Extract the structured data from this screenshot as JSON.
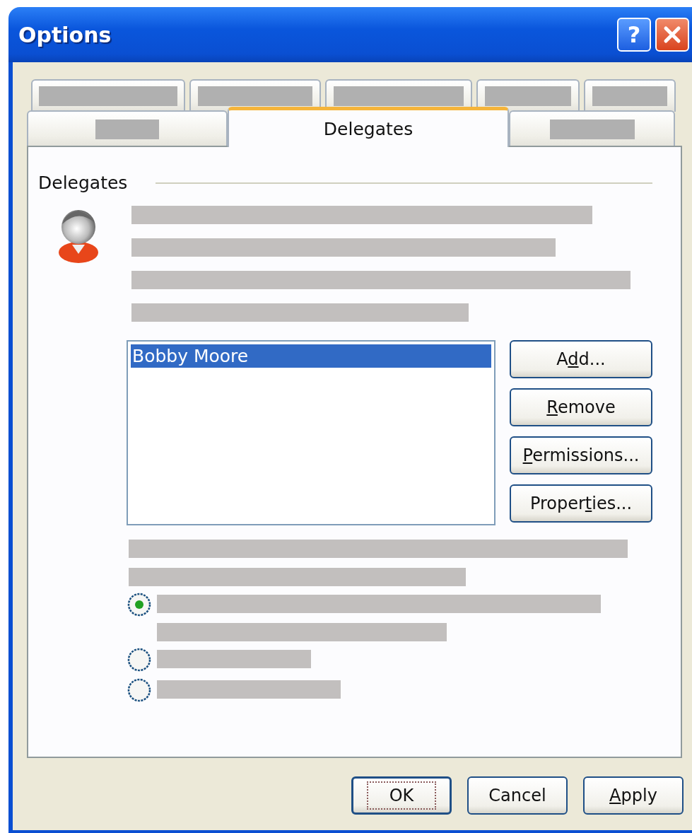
{
  "window": {
    "title": "Options"
  },
  "help_button": {
    "label": "?"
  },
  "tab_rows": [
    [
      {
        "kind": "redacted",
        "selected": false
      },
      {
        "kind": "redacted",
        "selected": false
      },
      {
        "kind": "redacted",
        "selected": false
      },
      {
        "kind": "redacted",
        "selected": false
      },
      {
        "kind": "redacted",
        "selected": false
      }
    ],
    [
      {
        "kind": "redacted",
        "selected": false
      },
      {
        "kind": "text",
        "label": "Delegates",
        "selected": true
      },
      {
        "kind": "redacted",
        "selected": false
      }
    ]
  ],
  "group": {
    "title": "Delegates"
  },
  "intro_lines": [
    {
      "kind": "redacted"
    },
    {
      "kind": "redacted"
    },
    {
      "kind": "redacted"
    },
    {
      "kind": "redacted"
    }
  ],
  "delegates_list": {
    "items": [
      {
        "name": "Bobby Moore",
        "selected": true
      }
    ]
  },
  "side_buttons": [
    {
      "parts": [
        {
          "text": "A",
          "underline": false
        },
        {
          "text": "d",
          "underline": true
        },
        {
          "text": "d...",
          "underline": false
        }
      ]
    },
    {
      "parts": [
        {
          "text": "R",
          "underline": true
        },
        {
          "text": "emove",
          "underline": false
        }
      ]
    },
    {
      "parts": [
        {
          "text": "P",
          "underline": true
        },
        {
          "text": "ermissions...",
          "underline": false
        }
      ]
    },
    {
      "parts": [
        {
          "text": "Proper",
          "underline": false
        },
        {
          "text": "t",
          "underline": true
        },
        {
          "text": "ies...",
          "underline": false
        }
      ]
    }
  ],
  "after_lines": [
    {
      "kind": "redacted"
    },
    {
      "kind": "redacted"
    }
  ],
  "radios": [
    {
      "selected": true,
      "lines": [
        {
          "kind": "redacted"
        },
        {
          "kind": "redacted"
        }
      ]
    },
    {
      "selected": false,
      "lines": [
        {
          "kind": "redacted"
        }
      ]
    },
    {
      "selected": false,
      "lines": [
        {
          "kind": "redacted"
        }
      ]
    }
  ],
  "footer_buttons": [
    {
      "focused": true,
      "parts": [
        {
          "text": "OK",
          "underline": false
        }
      ]
    },
    {
      "focused": false,
      "parts": [
        {
          "text": "Cancel",
          "underline": false
        }
      ]
    },
    {
      "focused": false,
      "parts": [
        {
          "text": "A",
          "underline": true
        },
        {
          "text": "pply",
          "underline": false
        }
      ]
    }
  ]
}
